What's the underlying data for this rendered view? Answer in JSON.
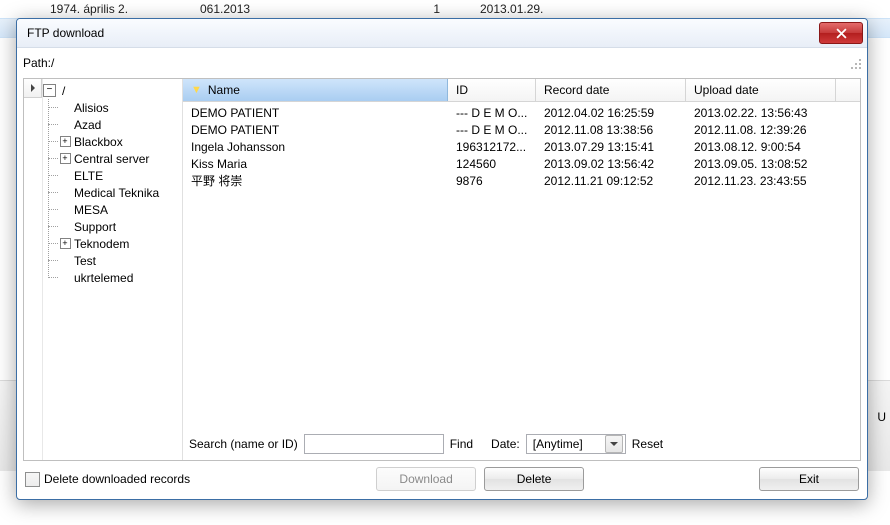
{
  "bg_rows": [
    {
      "c1": "1974. április 2.",
      "c2": "061.2013",
      "c3": "1",
      "c4": "2013.01.29."
    }
  ],
  "bg_right_char": "U",
  "window": {
    "title": "FTP download",
    "path_label": "Path:/",
    "tree_root": "/",
    "tree_items": [
      {
        "label": "Alisios",
        "expandable": false
      },
      {
        "label": "Azad",
        "expandable": false
      },
      {
        "label": "Blackbox",
        "expandable": true
      },
      {
        "label": "Central server",
        "expandable": true
      },
      {
        "label": "ELTE",
        "expandable": false
      },
      {
        "label": "Medical Teknika",
        "expandable": false
      },
      {
        "label": "MESA",
        "expandable": false
      },
      {
        "label": "Support",
        "expandable": false
      },
      {
        "label": "Teknodem",
        "expandable": true
      },
      {
        "label": "Test",
        "expandable": false
      },
      {
        "label": "ukrtelemed",
        "expandable": false
      }
    ],
    "columns": {
      "name": "Name",
      "id": "ID",
      "record": "Record date",
      "upload": "Upload date"
    },
    "rows": [
      {
        "name": "DEMO PATIENT",
        "id": "--- D E M O...",
        "record": "2012.04.02 16:25:59",
        "upload": "2013.02.22. 13:56:43"
      },
      {
        "name": "DEMO PATIENT",
        "id": "--- D E M O...",
        "record": "2012.11.08 13:38:56",
        "upload": "2012.11.08. 12:39:26"
      },
      {
        "name": "Ingela Johansson",
        "id": "196312172...",
        "record": "2013.07.29 13:15:41",
        "upload": "2013.08.12. 9:00:54"
      },
      {
        "name": "Kiss Maria",
        "id": "124560",
        "record": "2013.09.02 13:56:42",
        "upload": "2013.09.05. 13:08:52"
      },
      {
        "name": "平野 将崇",
        "id": "9876",
        "record": "2012.11.21 09:12:52",
        "upload": "2012.11.23. 23:43:55"
      }
    ],
    "search_label": "Search (name or ID)",
    "find_label": "Find",
    "date_label": "Date:",
    "date_value": "[Anytime]",
    "reset_label": "Reset",
    "delete_downloaded_label": "Delete downloaded records",
    "buttons": {
      "download": "Download",
      "delete": "Delete",
      "exit": "Exit"
    }
  }
}
